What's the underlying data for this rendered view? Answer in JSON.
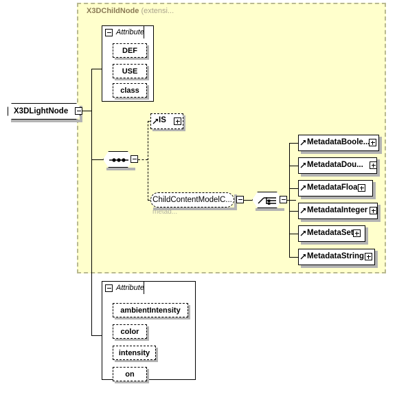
{
  "diagram": {
    "type": "xml-schema-element-diagram",
    "root_element": {
      "label": "X3DLightNode",
      "expander": "minus"
    },
    "extension_region": {
      "title": "X3DChildNode",
      "title_suffix": "(extensi...",
      "background_color": "#ffffcc",
      "border_color": "#b9b98f"
    },
    "attribute_groups": [
      {
        "id": "inherited-attributes",
        "header": "Attribute",
        "expander": "minus",
        "items": [
          {
            "label": "DEF"
          },
          {
            "label": "USE"
          },
          {
            "label": "class"
          }
        ]
      },
      {
        "id": "own-attributes",
        "header": "Attribute",
        "expander": "minus",
        "items": [
          {
            "label": "ambientIntensity"
          },
          {
            "label": "color"
          },
          {
            "label": "intensity"
          },
          {
            "label": "on"
          }
        ]
      }
    ],
    "compositors": [
      {
        "id": "sequence",
        "kind": "sequence",
        "expander": "minus"
      },
      {
        "id": "choice",
        "kind": "choice",
        "expander": "minus"
      }
    ],
    "elements": [
      {
        "id": "is",
        "label": "IS",
        "expander": "plus",
        "style": "dashed",
        "icon": "element-arrow-icon"
      }
    ],
    "group_reference": {
      "label": "ChildContentModelC...",
      "sub_label": "metad...",
      "expander": "minus"
    },
    "metadata_children": [
      {
        "label": "MetadataBoole...",
        "expander": "plus",
        "icon": "element-arrow-icon"
      },
      {
        "label": "MetadataDou...",
        "expander": "plus",
        "icon": "element-arrow-icon"
      },
      {
        "label": "MetadataFloat",
        "expander": "plus",
        "icon": "element-arrow-icon"
      },
      {
        "label": "MetadataInteger",
        "expander": "plus",
        "icon": "element-arrow-icon"
      },
      {
        "label": "MetadataSet",
        "expander": "plus",
        "icon": "element-arrow-icon"
      },
      {
        "label": "MetadataString",
        "expander": "plus",
        "icon": "element-arrow-icon"
      }
    ]
  }
}
